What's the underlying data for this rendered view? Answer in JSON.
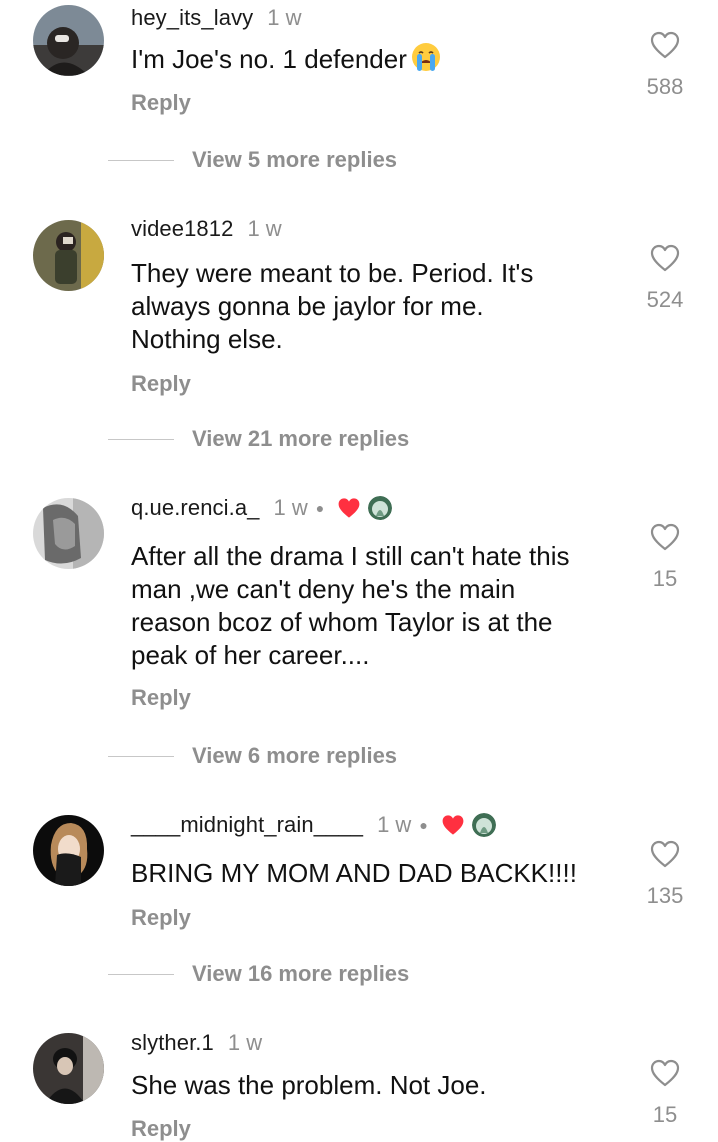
{
  "reply_label": "Reply",
  "comments": [
    {
      "username": "hey_its_lavy",
      "time": "1 w",
      "text": "I'm Joe's no. 1 defender",
      "emoji": "loudly-crying-face",
      "likes": "588",
      "view_more": "View 5 more replies",
      "creator_liked": false
    },
    {
      "username": "videe1812",
      "time": "1 w",
      "text": "They were meant to be. Period. It's\nalways gonna be jaylor for me.\nNothing else.",
      "likes": "524",
      "view_more": "View 21 more replies",
      "creator_liked": false
    },
    {
      "username": "q.ue.renci.a_",
      "time": "1 w",
      "text": "After all the drama I still can't hate this\nman ,we can't deny he's the main\nreason bcoz of whom Taylor is at the\npeak of her career....",
      "likes": "15",
      "view_more": "View 6 more replies",
      "creator_liked": true
    },
    {
      "username": "____midnight_rain____",
      "time": "1 w",
      "text": "BRING MY MOM AND DAD BACKK!!!!",
      "likes": "135",
      "view_more": "View 16 more replies",
      "creator_liked": true
    },
    {
      "username": "slyther.1",
      "time": "1 w",
      "text": "She was the problem. Not Joe.",
      "likes": "15",
      "creator_liked": false
    }
  ],
  "colors": {
    "text": "#111111",
    "muted": "#8e8e8e",
    "heart_red": "#ff3040",
    "divider": "#c7c7c7"
  },
  "icons": {
    "like": "heart-outline-icon",
    "creator_like": "heart-filled-icon"
  }
}
